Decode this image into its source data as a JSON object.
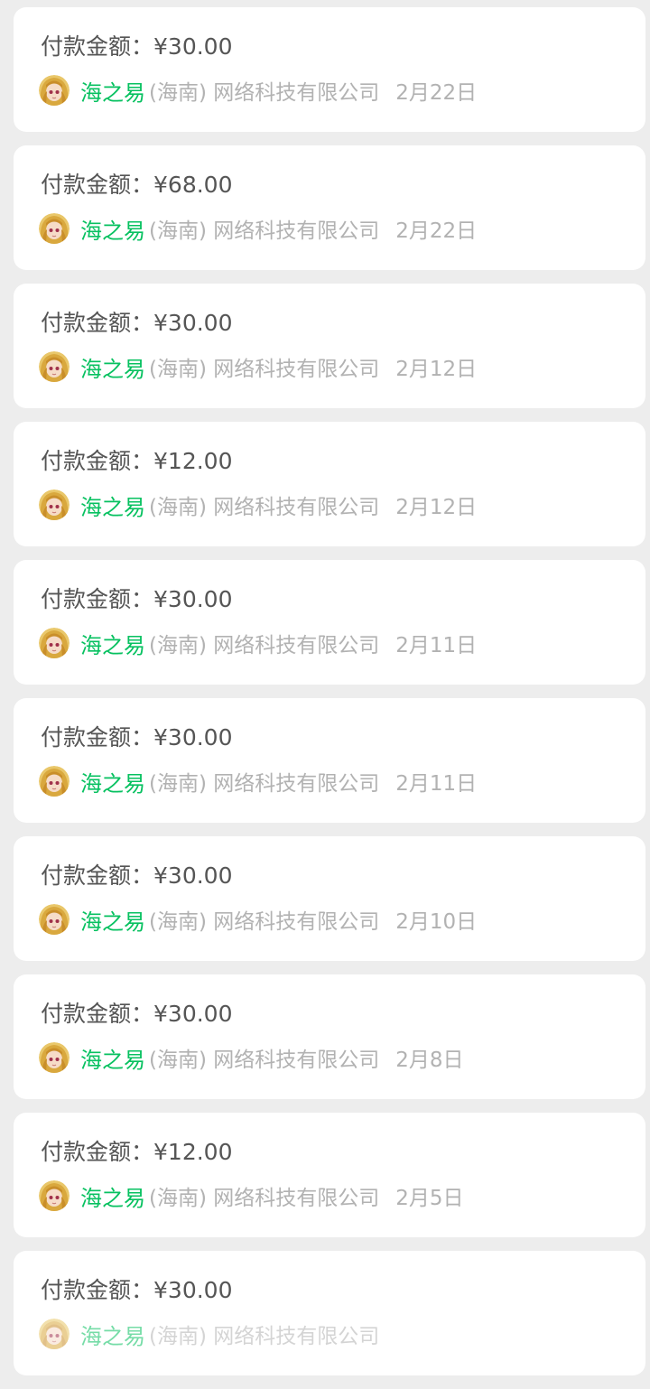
{
  "colors": {
    "background": "#ededed",
    "card": "#ffffff",
    "amount_text": "#555555",
    "brand_green": "#07c160",
    "muted_text": "#b2b2b2"
  },
  "payments": [
    {
      "amount_label": "付款金额：",
      "amount": "¥30.00",
      "merchant_brand": "海之易",
      "merchant_rest": "(海南) 网络科技有限公司",
      "date": "2月22日",
      "avatar_icon": "anime-girl-avatar-icon"
    },
    {
      "amount_label": "付款金额：",
      "amount": "¥68.00",
      "merchant_brand": "海之易",
      "merchant_rest": "(海南) 网络科技有限公司",
      "date": "2月22日",
      "avatar_icon": "anime-girl-avatar-icon"
    },
    {
      "amount_label": "付款金额：",
      "amount": "¥30.00",
      "merchant_brand": "海之易",
      "merchant_rest": "(海南) 网络科技有限公司",
      "date": "2月12日",
      "avatar_icon": "anime-girl-avatar-icon"
    },
    {
      "amount_label": "付款金额：",
      "amount": "¥12.00",
      "merchant_brand": "海之易",
      "merchant_rest": "(海南) 网络科技有限公司",
      "date": "2月12日",
      "avatar_icon": "anime-girl-avatar-icon"
    },
    {
      "amount_label": "付款金额：",
      "amount": "¥30.00",
      "merchant_brand": "海之易",
      "merchant_rest": "(海南) 网络科技有限公司",
      "date": "2月11日",
      "avatar_icon": "anime-girl-avatar-icon"
    },
    {
      "amount_label": "付款金额：",
      "amount": "¥30.00",
      "merchant_brand": "海之易",
      "merchant_rest": "(海南) 网络科技有限公司",
      "date": "2月11日",
      "avatar_icon": "anime-girl-avatar-icon"
    },
    {
      "amount_label": "付款金额：",
      "amount": "¥30.00",
      "merchant_brand": "海之易",
      "merchant_rest": "(海南) 网络科技有限公司",
      "date": "2月10日",
      "avatar_icon": "anime-girl-avatar-icon"
    },
    {
      "amount_label": "付款金额：",
      "amount": "¥30.00",
      "merchant_brand": "海之易",
      "merchant_rest": "(海南) 网络科技有限公司",
      "date": "2月8日",
      "avatar_icon": "anime-girl-avatar-icon"
    },
    {
      "amount_label": "付款金额：",
      "amount": "¥12.00",
      "merchant_brand": "海之易",
      "merchant_rest": "(海南) 网络科技有限公司",
      "date": "2月5日",
      "avatar_icon": "anime-girl-avatar-icon"
    },
    {
      "amount_label": "付款金额：",
      "amount": "¥30.00",
      "merchant_brand": "海之易",
      "merchant_rest": "(海南) 网络科技有限公司",
      "date": "",
      "avatar_icon": "anime-girl-avatar-icon"
    }
  ]
}
